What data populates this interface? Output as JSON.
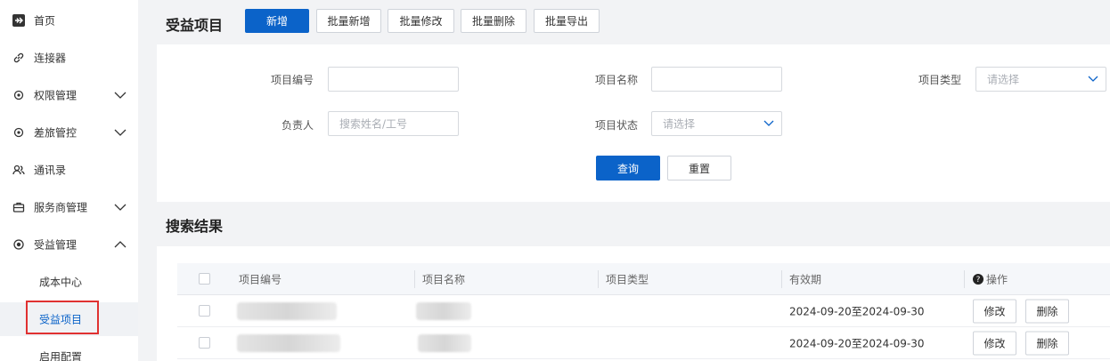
{
  "sidebar": {
    "items": [
      {
        "label": "首页",
        "icon": "airplane-icon"
      },
      {
        "label": "连接器",
        "icon": "link-icon"
      },
      {
        "label": "权限管理",
        "icon": "gear-icon"
      },
      {
        "label": "差旅管控",
        "icon": "gear-icon"
      },
      {
        "label": "通讯录",
        "icon": "contacts-icon"
      },
      {
        "label": "服务商管理",
        "icon": "briefcase-icon"
      },
      {
        "label": "受益管理",
        "icon": "coin-icon"
      }
    ],
    "sub_items": [
      {
        "label": "成本中心"
      },
      {
        "label": "受益项目"
      },
      {
        "label": "启用配置"
      }
    ]
  },
  "header": {
    "title": "受益项目",
    "buttons": {
      "add": "新增",
      "batch_add": "批量新增",
      "batch_edit": "批量修改",
      "batch_delete": "批量删除",
      "batch_export": "批量导出"
    }
  },
  "search_form": {
    "project_code_label": "项目编号",
    "project_name_label": "项目名称",
    "project_type_label": "项目类型",
    "project_type_placeholder": "请选择",
    "owner_label": "负责人",
    "owner_placeholder": "搜索姓名/工号",
    "project_status_label": "项目状态",
    "project_status_placeholder": "请选择",
    "query_button": "查询",
    "reset_button": "重置"
  },
  "results": {
    "title": "搜索结果",
    "columns": [
      "项目编号",
      "项目名称",
      "项目类型",
      "有效期",
      "操作"
    ],
    "rows": [
      {
        "validity": "2024-09-20至2024-09-30",
        "edit": "修改",
        "delete": "删除"
      },
      {
        "validity": "2024-09-20至2024-09-30",
        "edit": "修改",
        "delete": "删除"
      }
    ]
  },
  "colors": {
    "primary": "#0b63c9",
    "highlight_border": "#e03131"
  }
}
